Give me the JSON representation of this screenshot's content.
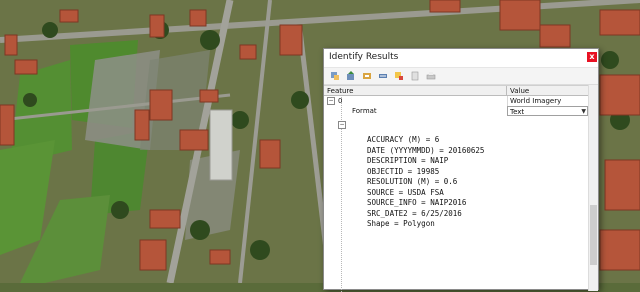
{
  "dialog": {
    "title": "Identify Results",
    "close_glyph": "x"
  },
  "toolbar": {
    "icons": [
      "expand-tree-icon",
      "collapse-tree-icon",
      "expand-new-icon",
      "clear-results-icon",
      "highlight-icon",
      "copy-icon",
      "print-icon"
    ]
  },
  "grid": {
    "columns": [
      "Feature",
      "Value"
    ],
    "rows": [
      {
        "feature": "0",
        "value": "World Imagery"
      },
      {
        "feature": "Format",
        "value": "Text"
      }
    ],
    "attributes": [
      "ACCURACY (M) = 6",
      "DATE (YYYYMMDD) = 20160625",
      "DESCRIPTION = NAIP",
      "OBJECTID = 19985",
      "RESOLUTION (M) = 0.6",
      "SOURCE = USDA FSA",
      "SOURCE_INFO = NAIP2016",
      "SRC_DATE2 = 6/25/2016",
      "Shape = Polygon"
    ]
  },
  "colors": {
    "close_button": "#e81123",
    "grass": "#4f8a2e",
    "roof": "#b5553a"
  }
}
